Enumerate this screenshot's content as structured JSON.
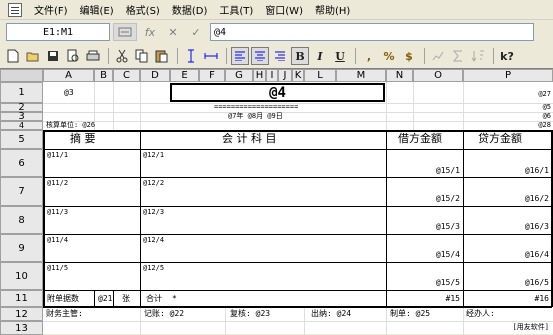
{
  "menubar": {
    "items": [
      "文件(F)",
      "编辑(E)",
      "格式(S)",
      "数据(D)",
      "工具(T)",
      "窗口(W)",
      "帮助(H)"
    ]
  },
  "formula_bar": {
    "cell_ref": "E1:M1",
    "formula": "@4",
    "fx_icon": "fx",
    "cancel_icon": "✕",
    "confirm_icon": "✓"
  },
  "toolbar": {
    "buttons": [
      "new-icon",
      "open-icon",
      "save-icon",
      "print-preview-icon",
      "print-icon",
      "cut-icon",
      "copy-icon",
      "paste-icon",
      "row-height-icon",
      "col-width-icon",
      "align-left-icon",
      "align-center-icon",
      "align-right-icon",
      "bold-icon",
      "italic-icon",
      "underline-icon",
      "comma-icon",
      "percent-icon",
      "currency-icon",
      "chart-icon",
      "sum-icon",
      "sort-icon",
      "help-icon"
    ],
    "labels": {
      "bold": "B",
      "italic": "I",
      "underline": "U",
      "comma": ",",
      "percent": "%",
      "currency": "$",
      "help": "k?"
    }
  },
  "sheet": {
    "columns": [
      "A",
      "B",
      "C",
      "D",
      "E",
      "F",
      "G",
      "H",
      "I",
      "J",
      "K",
      "L",
      "M",
      "N",
      "O",
      "P"
    ],
    "rows": [
      "1",
      "2",
      "3",
      "4",
      "5",
      "6",
      "7",
      "8",
      "9",
      "10",
      "11",
      "12",
      "13"
    ],
    "cells": {
      "a1": "@3",
      "e1": "@4",
      "p1": "@27",
      "p2": "@5",
      "e2": "====================",
      "p3": "@6",
      "e3": "@7年 @8月 @9日",
      "a4": "核算单位: @26",
      "p4": "@28",
      "h_summary": "摘    要",
      "h_account": "会  计  科  目",
      "h_debit": "借方金额",
      "h_credit": "贷方金额",
      "rows": [
        {
          "summary": "@11/1",
          "account": "@12/1",
          "debit": "@15/1",
          "credit": "@16/1"
        },
        {
          "summary": "@11/2",
          "account": "@12/2",
          "debit": "@15/2",
          "credit": "@16/2"
        },
        {
          "summary": "@11/3",
          "account": "@12/3",
          "debit": "@15/3",
          "credit": "@16/3"
        },
        {
          "summary": "@11/4",
          "account": "@12/4",
          "debit": "@15/4",
          "credit": "@16/4"
        },
        {
          "summary": "@11/5",
          "account": "@12/5",
          "debit": "@15/5",
          "credit": "@16/5"
        }
      ],
      "r11_label": "附单据数",
      "r11_count": "@21",
      "r11_unit": "张",
      "r11_total_label": "合计",
      "r11_total_mark": "*",
      "r11_debit": "#15",
      "r11_credit": "#16",
      "r12_supervisor": "财务主管:",
      "r12_bookkeeper": "记账: @22",
      "r12_reviewer": "复核: @23",
      "r12_cashier": "出纳: @24",
      "r12_maker": "制单: @25",
      "r12_handler": "经办人:",
      "r13_footer": "[用友软件]"
    }
  }
}
